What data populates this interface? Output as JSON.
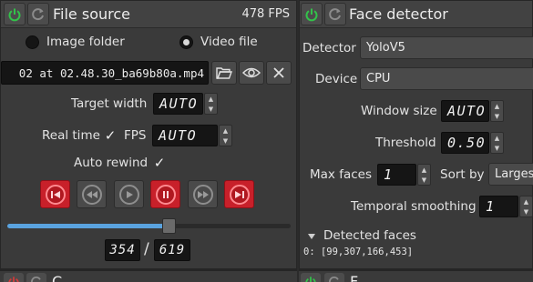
{
  "colors": {
    "power_green": "#33c24a",
    "reload_gray": "#8b8b8b",
    "accent_blue": "#5aa3df",
    "stop_red": "#c8202a"
  },
  "file_source": {
    "title": "File source",
    "fps": "478 FPS",
    "source_options": [
      {
        "label": "Image folder",
        "selected": false
      },
      {
        "label": "Video file",
        "selected": true
      }
    ],
    "path": "02 at 02.48.30_ba69b80a.mp4",
    "target_width_label": "Target width",
    "target_width_value": "AUTO",
    "real_time_label": "Real time",
    "real_time_checked": true,
    "fps_label": "FPS",
    "fps_value": "AUTO",
    "auto_rewind_label": "Auto rewind",
    "auto_rewind_checked": true,
    "playback_progress": 0.572,
    "current_frame": "354",
    "frame_separator": "/",
    "total_frames": "619",
    "icons": [
      "power-icon",
      "reload-icon",
      "folder-open-icon",
      "eye-icon",
      "close-icon",
      "skip-to-start-icon",
      "rewind-icon",
      "play-icon",
      "pause-icon",
      "fast-forward-icon",
      "skip-to-end-icon"
    ]
  },
  "face_detector": {
    "title": "Face detector",
    "detector_label": "Detector",
    "detector_value": "YoloV5",
    "device_label": "Device",
    "device_value": "CPU",
    "window_size_label": "Window size",
    "window_size_value": "AUTO",
    "threshold_label": "Threshold",
    "threshold_value": "0.50",
    "max_faces_label": "Max faces",
    "max_faces_value": "1",
    "sort_by_label": "Sort by",
    "sort_by_value": "Larges",
    "temporal_label": "Temporal smoothing",
    "temporal_value": "1",
    "detected_faces_label": "Detected faces",
    "detected_faces_value": "0: [99,307,166,453]"
  },
  "bottom_left_title": "C",
  "bottom_right_title": "F"
}
